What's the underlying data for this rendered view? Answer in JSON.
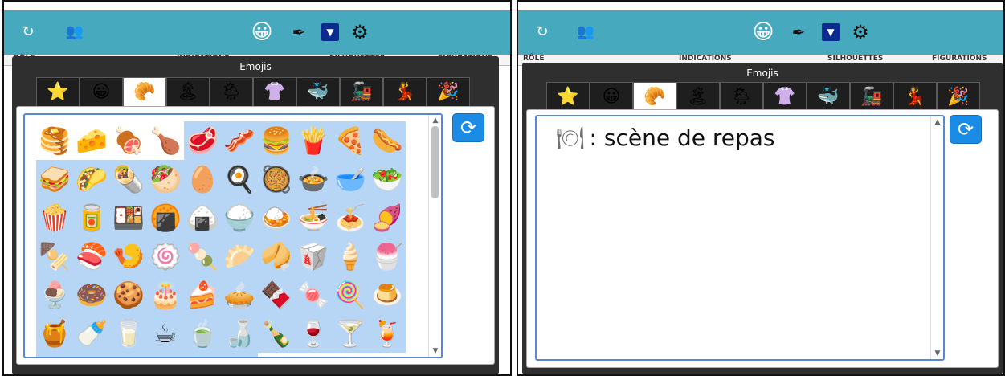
{
  "dialog": {
    "title": "Emojis"
  },
  "toolbar": {
    "refresh_icon": "↻",
    "group_icon": "👥",
    "emoji_icon": "😀",
    "pen_icon": "✒",
    "dropdown_icon": "▼",
    "gear_icon": "⚙"
  },
  "background_headers": [
    "RÔLE",
    "INDICATIONS",
    "SILHOUETTES",
    "FIGURATIONS"
  ],
  "tabs": [
    {
      "name": "favorites",
      "glyph": "⭐"
    },
    {
      "name": "smileys",
      "glyph": "😀"
    },
    {
      "name": "food",
      "glyph": "🥐"
    },
    {
      "name": "travel",
      "glyph": "🏝"
    },
    {
      "name": "weather",
      "glyph": "🌦"
    },
    {
      "name": "clothing",
      "glyph": "👚"
    },
    {
      "name": "animals",
      "glyph": "🐳"
    },
    {
      "name": "objects",
      "glyph": "🚂"
    },
    {
      "name": "activities",
      "glyph": "💃"
    },
    {
      "name": "celebration",
      "glyph": "🎉"
    }
  ],
  "active_tab": 2,
  "emojis": [
    "🥞",
    "🧀",
    "🍖",
    "🍗",
    "🥩",
    "🥓",
    "🍔",
    "🍟",
    "🍕",
    "🌭",
    "🥪",
    "🌮",
    "🌯",
    "🥙",
    "🥚",
    "🍳",
    "🥘",
    "🍲",
    "🥣",
    "🥗",
    "🍿",
    "🥫",
    "🍱",
    "🍘",
    "🍙",
    "🍚",
    "🍛",
    "🍜",
    "🍝",
    "🍠",
    "🍢",
    "🍣",
    "🍤",
    "🍥",
    "🍡",
    "🥟",
    "🥠",
    "🥡",
    "🍦",
    "🍧",
    "🍨",
    "🍩",
    "🍪",
    "🎂",
    "🍰",
    "🥧",
    "🍫",
    "🍬",
    "🍭",
    "🍮",
    "🍯",
    "🍼",
    "🥛",
    "☕",
    "🍵",
    "🍶",
    "🍾",
    "🍷",
    "🍸",
    "🍹",
    "🍺",
    "🍻",
    "🥂",
    "🥃",
    "🥤",
    "🥢",
    "🍽",
    "🍴",
    "🥄",
    "🏺"
  ],
  "selected_range": [
    4,
    65
  ],
  "description": {
    "glyph": "🍽",
    "text": ": scène de repas"
  },
  "refresh_button": "⟳",
  "scroll": {
    "up": "▲",
    "down": "▼"
  }
}
